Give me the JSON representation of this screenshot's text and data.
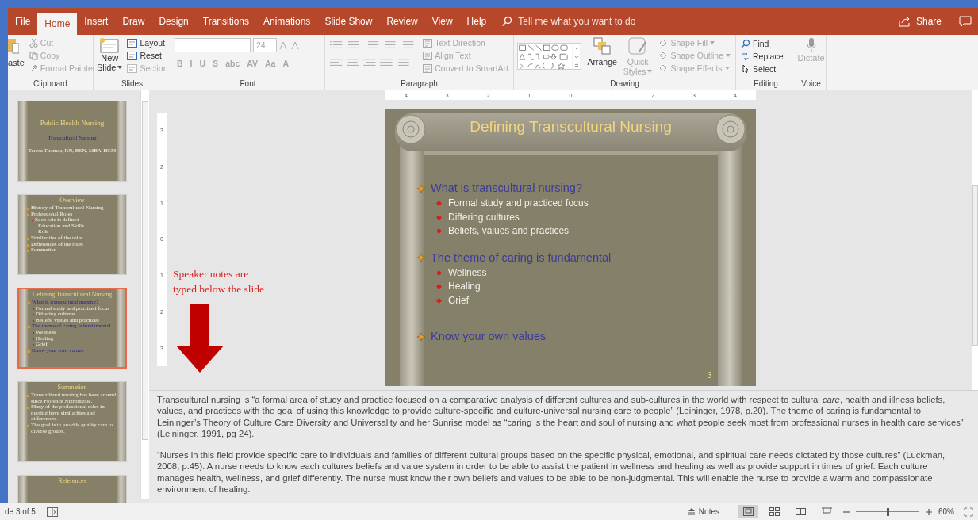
{
  "tabs": [
    {
      "label": "File",
      "selected": false
    },
    {
      "label": "Home",
      "selected": true
    },
    {
      "label": "Insert",
      "selected": false
    },
    {
      "label": "Draw",
      "selected": false
    },
    {
      "label": "Design",
      "selected": false
    },
    {
      "label": "Transitions",
      "selected": false
    },
    {
      "label": "Animations",
      "selected": false
    },
    {
      "label": "Slide Show",
      "selected": false
    },
    {
      "label": "Review",
      "selected": false
    },
    {
      "label": "View",
      "selected": false
    },
    {
      "label": "Help",
      "selected": false
    }
  ],
  "tell_me": {
    "placeholder": "Tell me what you want to do"
  },
  "share": "Share",
  "ribbon": {
    "clipboard": {
      "label": "Clipboard",
      "paste": "aste",
      "items": [
        {
          "kind": "scissors",
          "label": "Cut",
          "disabled": true
        },
        {
          "kind": "copy",
          "label": "Copy",
          "disabled": true
        },
        {
          "kind": "paintbrush",
          "label": "Format Painter",
          "disabled": true
        }
      ]
    },
    "slides": {
      "label": "Slides",
      "new_slide": [
        "New",
        "Slide"
      ],
      "items": [
        {
          "label": "Layout",
          "disabled": false
        },
        {
          "label": "Reset",
          "disabled": false
        },
        {
          "label": "Section",
          "disabled": true
        }
      ]
    },
    "font": {
      "label": "Font",
      "disabled": true,
      "size": "24",
      "buttons": [
        "B",
        "I",
        "U",
        "S",
        "abc",
        "AV",
        "Aa",
        "A"
      ]
    },
    "paragraph": {
      "label": "Paragraph",
      "items": [
        {
          "label": "Text Direction",
          "disabled": true
        },
        {
          "label": "Align Text",
          "disabled": true
        },
        {
          "label": "Convert to SmartArt",
          "disabled": true
        }
      ]
    },
    "drawing": {
      "label": "Drawing",
      "arrange": "Arrange",
      "quick_styles": {
        "lines": [
          "Quick",
          "Styles"
        ],
        "disabled": true
      },
      "items": [
        {
          "label": "Shape Fill",
          "disabled": true
        },
        {
          "label": "Shape Outline",
          "disabled": true
        },
        {
          "label": "Shape Effects",
          "disabled": true
        }
      ]
    },
    "editing": {
      "label": "Editing",
      "items": [
        {
          "kind": "search",
          "label": "Find",
          "disabled": false
        },
        {
          "kind": "replace",
          "label": "Replace",
          "disabled": false
        },
        {
          "kind": "pointer",
          "label": "Select",
          "disabled": false
        }
      ]
    },
    "voice": {
      "label": "Voice",
      "dictate": "Dictate",
      "disabled": true
    }
  },
  "thumbnails": [
    {
      "selected": false,
      "title": "Public Health Nursing",
      "lines": [
        "Transcultural Nursing",
        "Teresa Thomas, RN, BSN, MBA-HCM"
      ]
    },
    {
      "selected": false,
      "title": "Overview",
      "bullets": [
        {
          "text": "History of Transcultural Nursing"
        },
        {
          "text": "Professional Roles",
          "children": [
            {
              "text": "Each role is defined",
              "children": [
                {
                  "text": "Education and Skills"
                },
                {
                  "text": "Role"
                }
              ]
            }
          ]
        },
        {
          "text": "Similarities of the roles"
        },
        {
          "text": "Differences of the roles"
        },
        {
          "text": "Summation"
        }
      ]
    },
    {
      "selected": true,
      "title": "Defining Transcultural Nursing",
      "bullets": [
        {
          "text": "What is transcultural nursing?",
          "children": [
            {
              "text": "Formal study and practiced focus"
            },
            {
              "text": "Differing cultures"
            },
            {
              "text": "Beliefs, values and practices"
            }
          ]
        },
        {
          "text": "The theme of caring is fundamental",
          "children": [
            {
              "text": "Wellness"
            },
            {
              "text": "Healing"
            },
            {
              "text": "Grief"
            }
          ]
        },
        {
          "text": "Know your own values"
        }
      ]
    },
    {
      "selected": false,
      "title": "Summation",
      "bullets": [
        {
          "text": "Transcultural nursing has been around since Florence Nightingale."
        },
        {
          "text": "Many of the professional roles in nursing have similarities and differences."
        },
        {
          "text": "The goal is to provide quality care to diverse groups."
        }
      ]
    },
    {
      "selected": false,
      "title": "References"
    }
  ],
  "h_ruler": [
    "4",
    "3",
    "2",
    "1",
    "0",
    "1",
    "2",
    "3",
    "4"
  ],
  "v_ruler": [
    "3",
    "2",
    "1",
    "0",
    "1",
    "2",
    "3"
  ],
  "annotation": "Speaker notes are typed below the slide",
  "slide": {
    "title": "Defining Transcultural Nursing",
    "number": "3",
    "bullets": [
      {
        "text": "What is transcultural nursing?",
        "children": [
          {
            "text": "Formal study and practiced focus"
          },
          {
            "text": "Differing cultures"
          },
          {
            "text": "Beliefs, values and practices"
          }
        ]
      },
      {
        "text": "The theme of caring is fundamental",
        "children": [
          {
            "text": "Wellness"
          },
          {
            "text": "Healing"
          },
          {
            "text": "Grief"
          }
        ]
      },
      {
        "text": "Know your own values"
      }
    ]
  },
  "notes": [
    "Transcultural nursing is “a formal area of study and practice focused on a comparative analysis of different cultures and sub-cultures in the world with respect to cultural *care*, health and illness beliefs, values, and practices with the goal of using this knowledge to provide culture-specific and culture-universal nursing care to people” (Leininger, 1978, p.20). The theme of caring is fundamental to Leininger’s Theory of Culture Care Diversity and Universality and her Sunrise model as “caring is the heart and soul of nursing and what people seek most from professional nurses in health care services” (Leininger, 1991, pg 24).",
    "“Nurses in this field provide specific care to individuals and families of different cultural groups based on the specific physical, emotional, and spiritual care needs dictated by those cultures” (Luckman, 2008, p.45). A nurse needs to know each cultures beliefs and value system in order to be able to assist the patient in wellness and healing as well as provide support in times of grief. Each culture manages health, wellness, and grief differently. The nurse must know their own beliefs and values to be able to be non-judgmental. This will enable the nurse to provide a warm and compassionate environment of healing."
  ],
  "status": {
    "slide_info": "de 3 of 5",
    "notes": "Notes",
    "views": [
      {
        "kind": "normal",
        "selected": true
      },
      {
        "kind": "sorter",
        "selected": false
      },
      {
        "kind": "reading",
        "selected": false
      },
      {
        "kind": "slideshow",
        "selected": false
      }
    ],
    "zoom": {
      "level": 0.5,
      "reading": "60%"
    }
  }
}
